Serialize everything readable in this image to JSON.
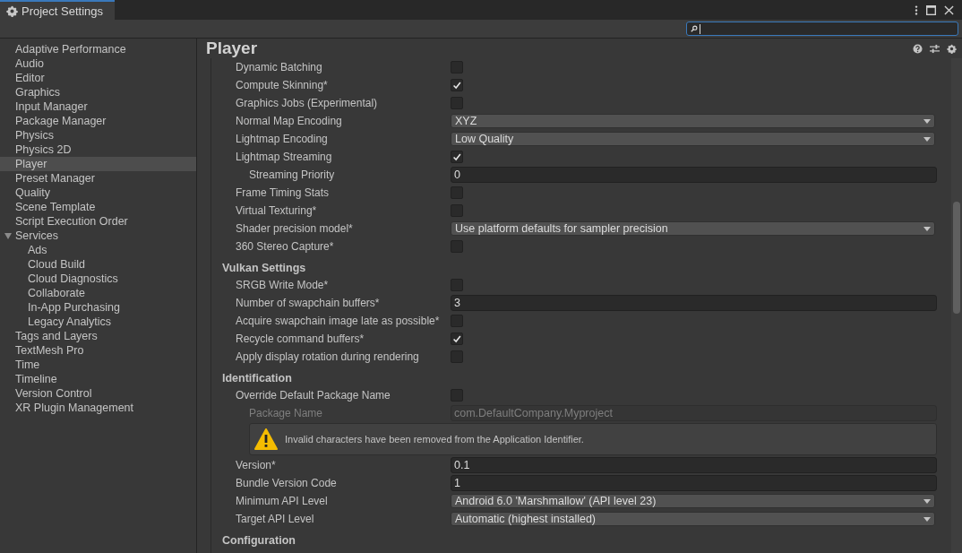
{
  "window": {
    "tab_title": "Project Settings"
  },
  "sidebar": {
    "items": [
      {
        "label": "Adaptive Performance",
        "selected": false
      },
      {
        "label": "Audio",
        "selected": false
      },
      {
        "label": "Editor",
        "selected": false
      },
      {
        "label": "Graphics",
        "selected": false
      },
      {
        "label": "Input Manager",
        "selected": false
      },
      {
        "label": "Package Manager",
        "selected": false
      },
      {
        "label": "Physics",
        "selected": false
      },
      {
        "label": "Physics 2D",
        "selected": false
      },
      {
        "label": "Player",
        "selected": true
      },
      {
        "label": "Preset Manager",
        "selected": false
      },
      {
        "label": "Quality",
        "selected": false
      },
      {
        "label": "Scene Template",
        "selected": false
      },
      {
        "label": "Script Execution Order",
        "selected": false
      },
      {
        "label": "Services",
        "selected": false,
        "expanded": true,
        "children": [
          {
            "label": "Ads",
            "selected": false
          },
          {
            "label": "Cloud Build",
            "selected": false
          },
          {
            "label": "Cloud Diagnostics",
            "selected": false
          },
          {
            "label": "Collaborate",
            "selected": false
          },
          {
            "label": "In-App Purchasing",
            "selected": false
          },
          {
            "label": "Legacy Analytics",
            "selected": false
          }
        ]
      },
      {
        "label": "Tags and Layers",
        "selected": false
      },
      {
        "label": "TextMesh Pro",
        "selected": false
      },
      {
        "label": "Time",
        "selected": false
      },
      {
        "label": "Timeline",
        "selected": false
      },
      {
        "label": "Version Control",
        "selected": false
      },
      {
        "label": "XR Plugin Management",
        "selected": false
      }
    ]
  },
  "inspector": {
    "title": "Player",
    "rows": [
      {
        "kind": "checkbox",
        "label": "Dynamic Batching",
        "checked": false
      },
      {
        "kind": "checkbox",
        "label": "Compute Skinning*",
        "checked": true
      },
      {
        "kind": "checkbox",
        "label": "Graphics Jobs (Experimental)",
        "checked": false
      },
      {
        "kind": "dropdown",
        "label": "Normal Map Encoding",
        "value": "XYZ"
      },
      {
        "kind": "dropdown",
        "label": "Lightmap Encoding",
        "value": "Low Quality"
      },
      {
        "kind": "checkbox",
        "label": "Lightmap Streaming",
        "checked": true,
        "children": [
          {
            "kind": "field",
            "label": "Streaming Priority",
            "value": "0",
            "disabled": false
          }
        ]
      },
      {
        "kind": "checkbox",
        "label": "Frame Timing Stats",
        "checked": false
      },
      {
        "kind": "checkbox",
        "label": "Virtual Texturing*",
        "checked": false
      },
      {
        "kind": "dropdown",
        "label": "Shader precision model*",
        "value": "Use platform defaults for sampler precision"
      },
      {
        "kind": "checkbox",
        "label": "360 Stereo Capture*",
        "checked": false
      },
      {
        "kind": "header",
        "label": "Vulkan Settings"
      },
      {
        "kind": "checkbox",
        "label": "SRGB Write Mode*",
        "checked": false
      },
      {
        "kind": "field",
        "label": "Number of swapchain buffers*",
        "value": "3",
        "disabled": false
      },
      {
        "kind": "checkbox",
        "label": "Acquire swapchain image late as possible*",
        "checked": false
      },
      {
        "kind": "checkbox",
        "label": "Recycle command buffers*",
        "checked": true
      },
      {
        "kind": "checkbox",
        "label": "Apply display rotation during rendering",
        "checked": false
      },
      {
        "kind": "header",
        "label": "Identification"
      },
      {
        "kind": "checkbox",
        "label": "Override Default Package Name",
        "checked": false,
        "children": [
          {
            "kind": "field",
            "label": "Package Name",
            "value": "com.DefaultCompany.Myproject",
            "disabled": true
          },
          {
            "kind": "warning",
            "label": "Invalid characters have been removed from the Application Identifier."
          }
        ]
      },
      {
        "kind": "field",
        "label": "Version*",
        "value": "0.1",
        "disabled": false
      },
      {
        "kind": "field",
        "label": "Bundle Version Code",
        "value": "1",
        "disabled": false
      },
      {
        "kind": "dropdown",
        "label": "Minimum API Level",
        "value": "Android 6.0 'Marshmallow' (API level 23)"
      },
      {
        "kind": "dropdown",
        "label": "Target API Level",
        "value": "Automatic (highest installed)"
      },
      {
        "kind": "header",
        "label": "Configuration"
      }
    ]
  }
}
